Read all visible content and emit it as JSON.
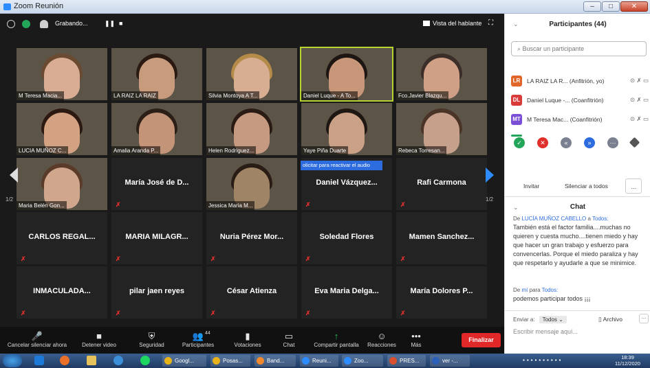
{
  "window": {
    "title": "Zoom Reunión",
    "min": "–",
    "max": "□",
    "close": "✕"
  },
  "topbar": {
    "recording": "Grabando...",
    "pause": "❚❚",
    "stop": "■",
    "view": "Vista del hablante",
    "fullscreen": "⛶"
  },
  "tiles": [
    {
      "name": "M Teresa Macia...",
      "hair": "#6b4a32",
      "face": "#d8ad93"
    },
    {
      "name": "LA RAIZ LA RAIZ",
      "hair": "#2a1a12",
      "face": "#c79b7c"
    },
    {
      "name": "Silvia Montoya A T...",
      "hair": "#b58b4a",
      "face": "#d8ae92"
    },
    {
      "name": "Daniel Luque - A To...",
      "hair": "#1e1612",
      "face": "#c89779",
      "active": true
    },
    {
      "name": "Fco.Javier Blazqu...",
      "hair": "#3b2e28",
      "face": "#cf9f86"
    },
    {
      "name": "LUCIA MUÑOZ C...",
      "hair": "#2c1a12",
      "face": "#d3a283"
    },
    {
      "name": "Amalia Aranda P...",
      "hair": "#2c1f18",
      "face": "#c49478"
    },
    {
      "name": "Helen Rodriguez...",
      "hair": "#2a1c14",
      "face": "#c69a80"
    },
    {
      "name": "Yaye Piña Duarte",
      "hair": "#1f1712",
      "face": "#caa186"
    },
    {
      "name": "Rebeca Torresan...",
      "hair": "#4a3427",
      "face": "#c7a08c"
    },
    {
      "name": "Maria Belén Gon...",
      "hair": "#5a3a28",
      "face": "#d0a68d"
    },
    {
      "name": "María José de D...",
      "big": true
    },
    {
      "name": "Jessica Maria M...",
      "hair": "#2a1d16",
      "face": "#9f8466"
    },
    {
      "name": "Daniel Vázquez...",
      "big": true
    },
    {
      "name": "Rafi Carmona",
      "big": true
    },
    {
      "name": "CARLOS REGAL...",
      "big": true
    },
    {
      "name": "MARIA MILAGR...",
      "big": true
    },
    {
      "name": "Nuria Pérez Mor...",
      "big": true
    },
    {
      "name": "Soledad Flores",
      "big": true
    },
    {
      "name": "Mamen Sanchez...",
      "big": true
    },
    {
      "name": "INMACULADA...",
      "big": true
    },
    {
      "name": "pilar jaen reyes",
      "big": true
    },
    {
      "name": "César Atienza",
      "big": true
    },
    {
      "name": "Eva Maria Delga...",
      "big": true
    },
    {
      "name": "María Dolores P...",
      "big": true
    }
  ],
  "page_indicator": "1/2",
  "unmute_popup": "olicitar para reactivar el audio",
  "toolbar": [
    {
      "label": "Cancelar silenciar ahora",
      "icon": "🎤"
    },
    {
      "label": "Detener video",
      "icon": "■"
    },
    {
      "label": "Seguridad",
      "icon": "⛨"
    },
    {
      "label": "Participantes",
      "icon": "👥",
      "count": "44"
    },
    {
      "label": "Votaciones",
      "icon": "▮"
    },
    {
      "label": "Chat",
      "icon": "▭"
    },
    {
      "label": "Compartir pantalla",
      "icon": "↑"
    },
    {
      "label": "Reacciones",
      "icon": "☺"
    },
    {
      "label": "Más",
      "icon": "•••"
    }
  ],
  "end_button": "Finalizar",
  "panel": {
    "title": "Participantes (44)",
    "search_placeholder": "Buscar un participante",
    "participants": [
      {
        "initials": "LR",
        "color": "#e0662a",
        "name": "LA RAIZ LA R...",
        "role": "(Anfitrión, yo)"
      },
      {
        "initials": "DL",
        "color": "#d93a3a",
        "name": "Daniel Luque -...",
        "role": "(Coanfitrión)"
      },
      {
        "initials": "MT",
        "color": "#7a4fd6",
        "name": "M Teresa Mac...",
        "role": "(Coanfitrión)"
      }
    ],
    "invite": "Invitar",
    "mute_all": "Silenciar a todos",
    "more": "..."
  },
  "chat": {
    "title": "Chat",
    "messages": [
      {
        "from_prefix": "De ",
        "from": "LUCÍA MUÑOZ CABELLO",
        "to_prefix": " a ",
        "to": "Todos:",
        "text": "También está el factor familia....muchas no quieren y cuesta mucho....tienen miedo y hay que hacer un gran trabajo y esfuerzo para convencerlas. Porque el miedo paraliza y hay que respetarlo y ayudarle a que se minimice."
      },
      {
        "from_prefix": "De ",
        "from": "mí",
        "to_prefix": " para ",
        "to": "Todos:",
        "text": "podemos participar todos ¡¡¡"
      }
    ],
    "send_to_label": "Enviar a:",
    "send_to_value": "Todos ⌄",
    "file": "Archivo",
    "placeholder": "Escribir mensaje aquí..."
  },
  "taskbar": [
    {
      "label": "Googl...",
      "color": "#e8b21a"
    },
    {
      "label": "Posas...",
      "color": "#e8b21a"
    },
    {
      "label": "Band...",
      "color": "#f0892d"
    },
    {
      "label": "Reuni...",
      "color": "#2d8cff"
    },
    {
      "label": "Zoo...",
      "color": "#2d8cff"
    },
    {
      "label": "PRES...",
      "color": "#d8502f"
    },
    {
      "label": "ver -...",
      "color": "#2b5fb8"
    }
  ],
  "clock": {
    "time": "18:39",
    "date": "11/12/2020"
  }
}
